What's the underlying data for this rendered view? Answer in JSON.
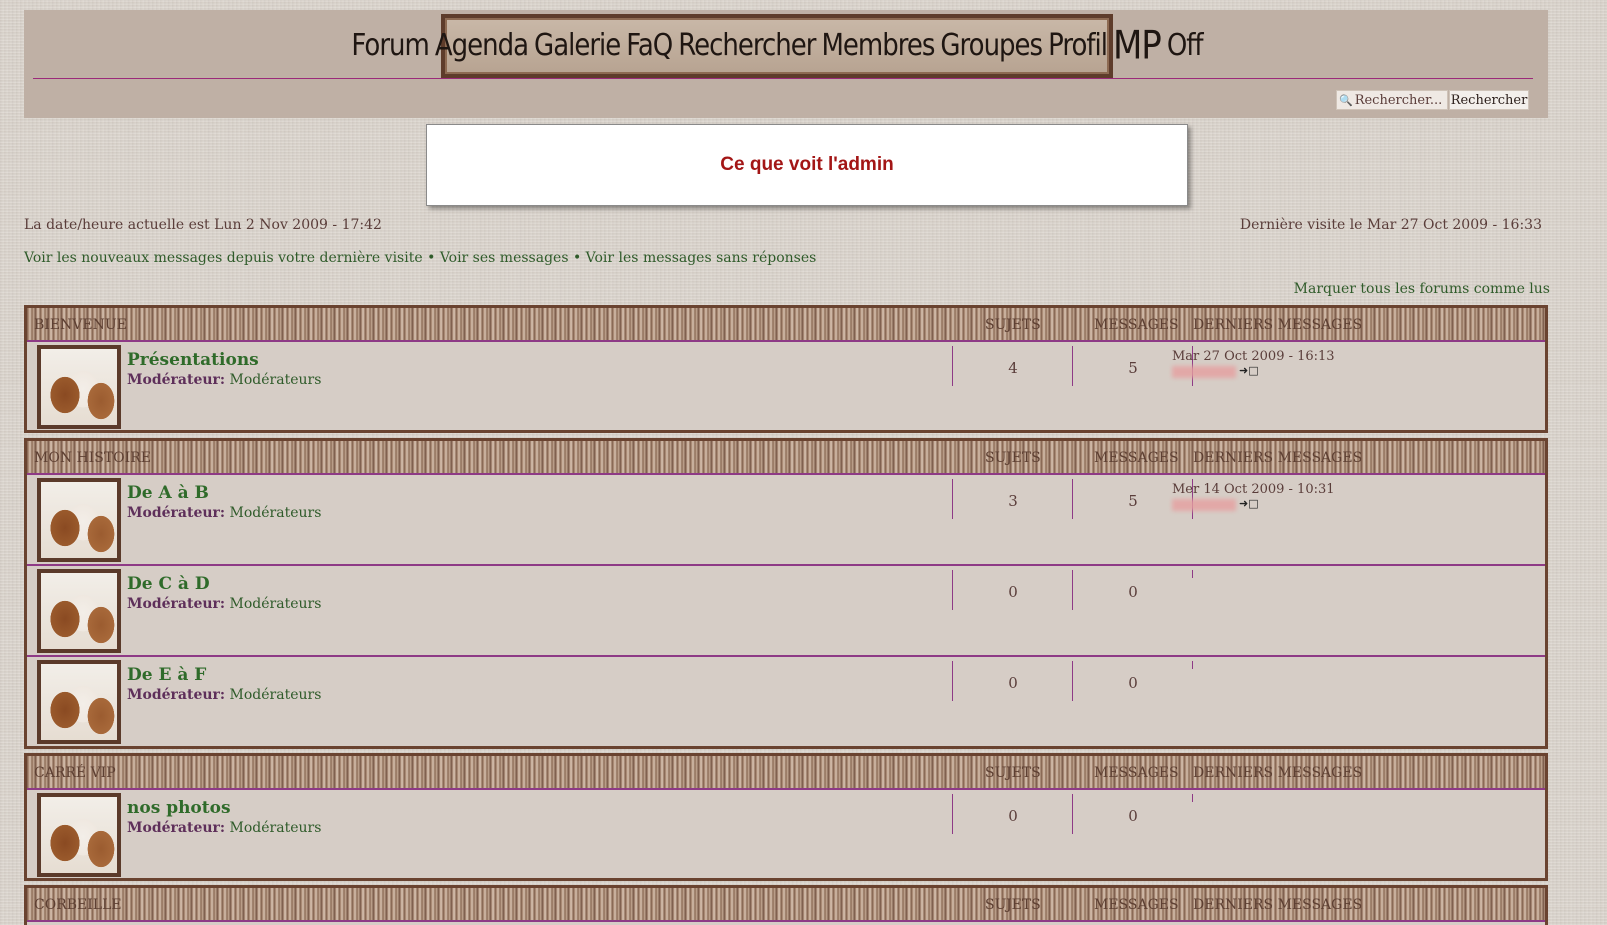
{
  "header": {
    "nav": [
      "Forum",
      "Agenda",
      "Galerie",
      "FaQ",
      "Rechercher",
      "Membres",
      "Groupes",
      "Profil",
      "MP",
      "Off"
    ],
    "search": {
      "placeholder": "Rechercher...",
      "button": "Rechercher"
    }
  },
  "overlay": {
    "text": "Ce que voit l'admin"
  },
  "info": {
    "current_time": "La date/heure actuelle est Lun 2 Nov 2009 - 17:42",
    "last_visit": "Dernière visite le Mar 27 Oct 2009 - 16:33",
    "links": [
      "Voir les nouveaux messages depuis votre dernière visite",
      "Voir ses messages",
      "Voir les messages sans réponses"
    ],
    "separator": "•",
    "mark_read": "Marquer tous les forums comme lus"
  },
  "columns": {
    "topics": "SUJETS",
    "posts": "MESSAGES",
    "last": "DERNIERS MESSAGES"
  },
  "moderator_label": "Modérateur:",
  "categories": [
    {
      "name": "BIENVENUE",
      "forums": [
        {
          "title": "Présentations",
          "moderator": "Modérateurs",
          "topics": "4",
          "posts": "5",
          "last_post": "Mar 27 Oct 2009 - 16:13"
        }
      ]
    },
    {
      "name": "MON HISTOIRE",
      "forums": [
        {
          "title": "De A à B",
          "moderator": "Modérateurs",
          "topics": "3",
          "posts": "5",
          "last_post": "Mer 14 Oct 2009 - 10:31"
        },
        {
          "title": "De C à D",
          "moderator": "Modérateurs",
          "topics": "0",
          "posts": "0",
          "last_post": ""
        },
        {
          "title": "De E à F",
          "moderator": "Modérateurs",
          "topics": "0",
          "posts": "0",
          "last_post": ""
        }
      ]
    },
    {
      "name": "CARRÉ VIP",
      "forums": [
        {
          "title": "nos photos",
          "moderator": "Modérateurs",
          "topics": "0",
          "posts": "0",
          "last_post": ""
        }
      ]
    },
    {
      "name": "CORBEILLE",
      "forums": []
    }
  ],
  "icons": {
    "search": "search-icon",
    "avatar": "dog-avatar-icon",
    "goto": "goto-last-post-icon"
  }
}
